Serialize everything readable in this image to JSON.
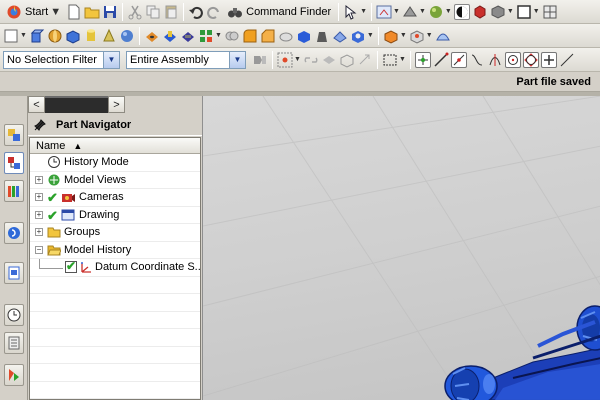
{
  "toolbar_standard": {
    "start_label": "Start",
    "command_finder_label": "Command Finder"
  },
  "selection_bar": {
    "filter_value": "No Selection Filter",
    "scope_value": "Entire Assembly"
  },
  "status": {
    "message": "Part file saved"
  },
  "navigator": {
    "title": "Part Navigator",
    "column_name": "Name",
    "items": [
      {
        "label": "History Mode",
        "icon": "clock-icon",
        "expandable": false,
        "checked": false
      },
      {
        "label": "Model Views",
        "icon": "model-views-icon",
        "expandable": true,
        "checked": false
      },
      {
        "label": "Cameras",
        "icon": "camera-icon",
        "expandable": true,
        "checked": true
      },
      {
        "label": "Drawing",
        "icon": "drawing-icon",
        "expandable": true,
        "checked": true
      },
      {
        "label": "Groups",
        "icon": "folder-icon",
        "expandable": true,
        "checked": false
      },
      {
        "label": "Model History",
        "icon": "folder-open-icon",
        "expandable": true,
        "expanded": true,
        "checked": false
      },
      {
        "label": "Datum Coordinate S...",
        "icon": "datum-csys-icon",
        "expandable": false,
        "checked": true
      }
    ]
  },
  "colors": {
    "toolbar_bg": "#e8e6df",
    "viewport_bg": "#cfcfcf",
    "model_blue": "#1f4fd1",
    "check_green": "#2aa22a",
    "folder_yellow": "#f2c53d"
  }
}
